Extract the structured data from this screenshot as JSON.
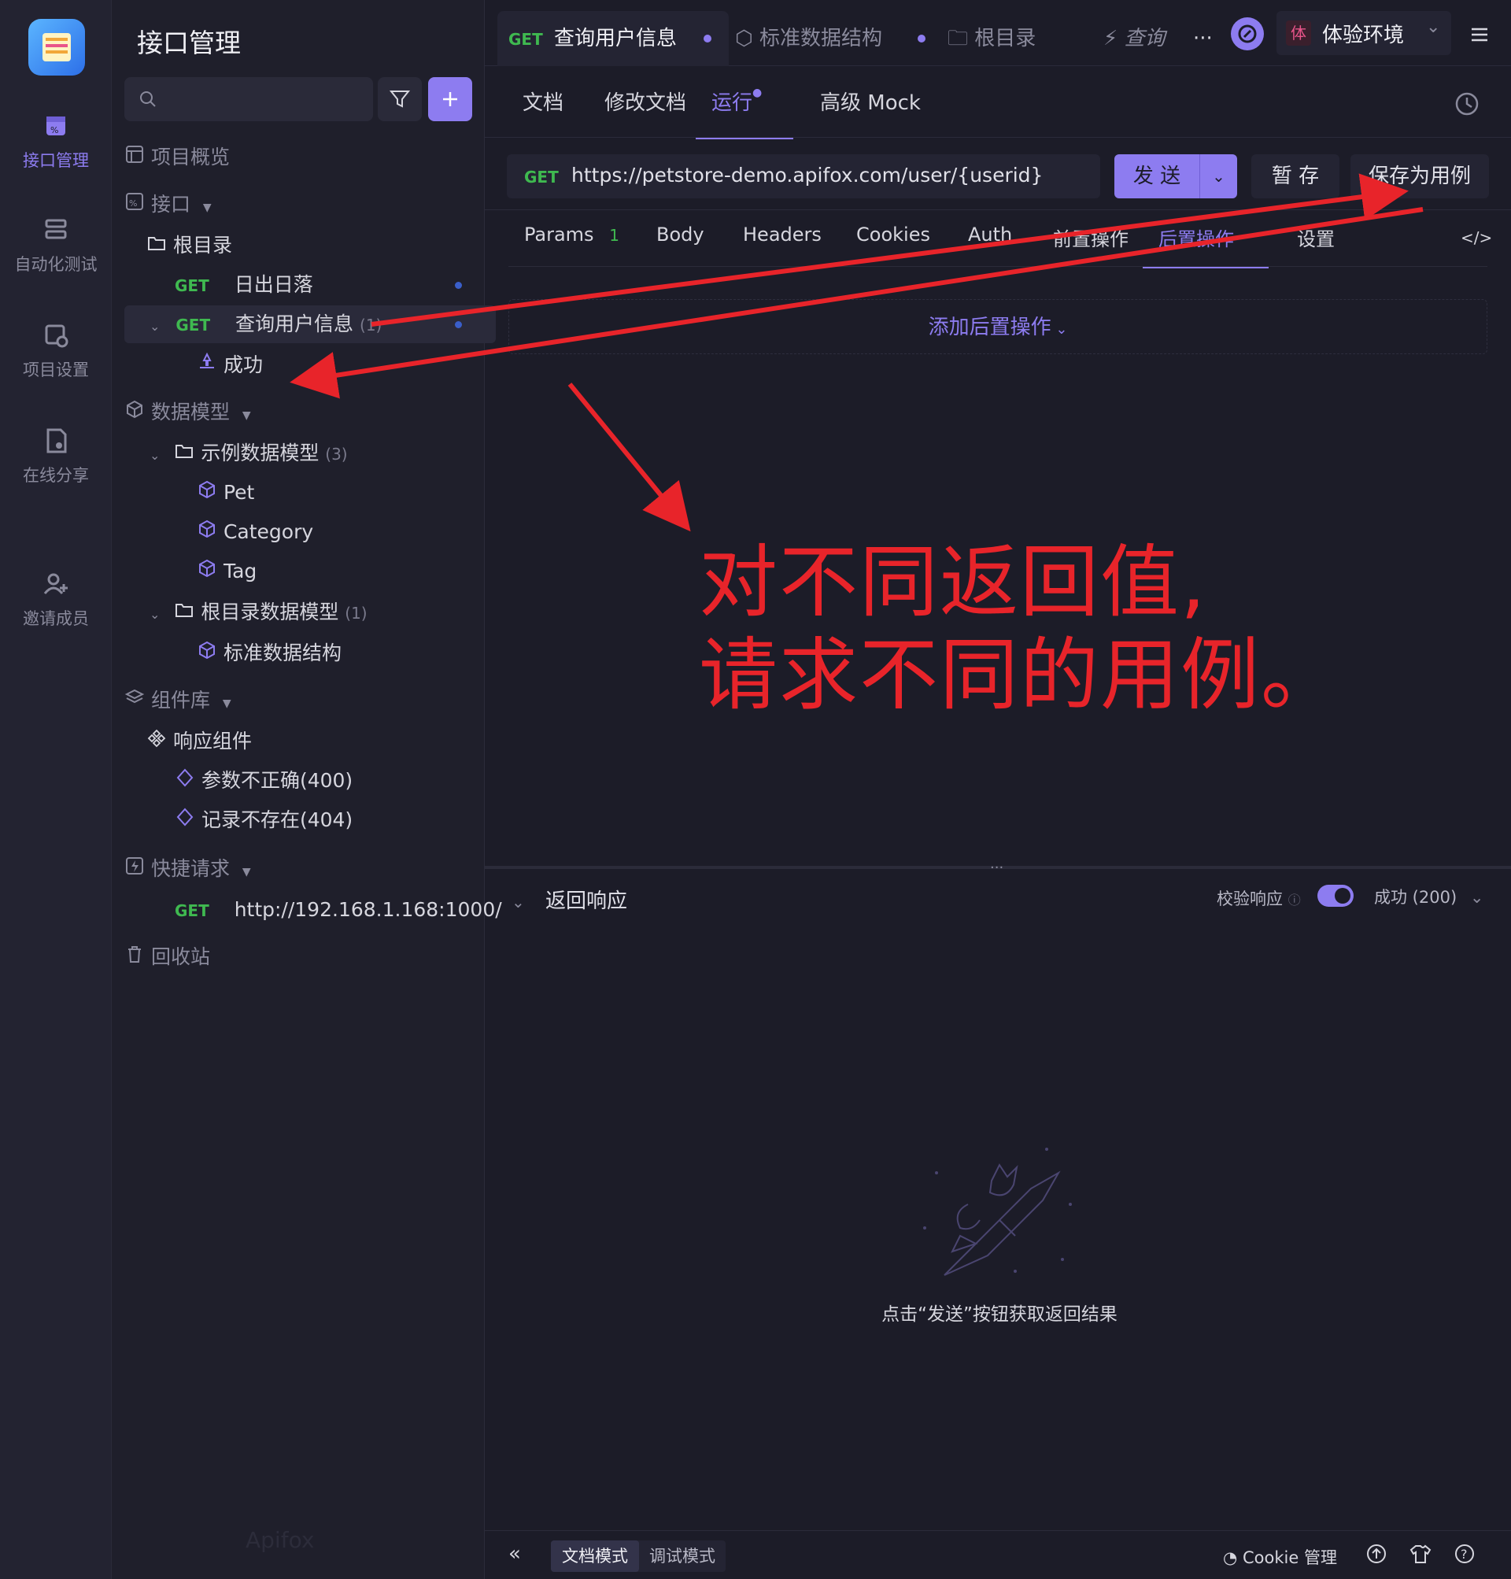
{
  "rail": {
    "items": [
      {
        "label": "接口管理",
        "icon": "api-management-icon"
      },
      {
        "label": "自动化测试",
        "icon": "automation-test-icon"
      },
      {
        "label": "项目设置",
        "icon": "project-settings-icon"
      },
      {
        "label": "在线分享",
        "icon": "online-share-icon"
      },
      {
        "label": "邀请成员",
        "icon": "invite-member-icon"
      }
    ]
  },
  "sidebar": {
    "title": "接口管理",
    "overview": "项目概览",
    "interfaces": "接口",
    "root": "根目录",
    "api1_method": "GET",
    "api1_name": "日出日落",
    "api2_method": "GET",
    "api2_name": "查询用户信息",
    "api2_count": "(1)",
    "case1": "成功",
    "data_models": "数据模型",
    "folder1": "示例数据模型",
    "folder1_count": "(3)",
    "model_pet": "Pet",
    "model_category": "Category",
    "model_tag": "Tag",
    "folder2": "根目录数据模型",
    "folder2_count": "(1)",
    "model_std": "标准数据结构",
    "components": "组件库",
    "resp_comp": "响应组件",
    "comp1": "参数不正确(400)",
    "comp2": "记录不存在(404)",
    "quick": "快捷请求",
    "quick_method": "GET",
    "quick_url": "http://192.168.1.168:1000/",
    "trash": "回收站",
    "watermark": "Apifox"
  },
  "tabs": {
    "t1_method": "GET",
    "t1_label": "查询用户信息",
    "t2_label": "标准数据结构",
    "t3_label": "根目录",
    "t4_label": "查询",
    "env": "体验环境",
    "env_badge": "体"
  },
  "subtabs": [
    "文档",
    "修改文档",
    "运行",
    "高级 Mock"
  ],
  "request": {
    "method": "GET",
    "url": "https://petstore-demo.apifox.com/user/{userid}",
    "send": "发 送",
    "stash": "暂 存",
    "save_case": "保存为用例"
  },
  "params_tabs": {
    "params": "Params",
    "params_count": "1",
    "body": "Body",
    "headers": "Headers",
    "cookies": "Cookies",
    "auth": "Auth",
    "pre": "前置操作",
    "post": "后置操作",
    "settings": "设置"
  },
  "add_post": "添加后置操作",
  "annotation": {
    "line1": "对不同返回值,",
    "line2": "请求不同的用例。"
  },
  "response": {
    "title": "返回响应",
    "validate": "校验响应",
    "status": "成功 (200)",
    "empty_hint": "点击“发送”按钮获取返回结果"
  },
  "footer": {
    "doc_mode": "文档模式",
    "debug_mode": "调试模式",
    "cookie_mgmt": "Cookie 管理"
  },
  "colors": {
    "accent": "#8d7cf0",
    "get": "#3fb950",
    "annotation": "#e8242a",
    "bg": "#1c1c28"
  }
}
